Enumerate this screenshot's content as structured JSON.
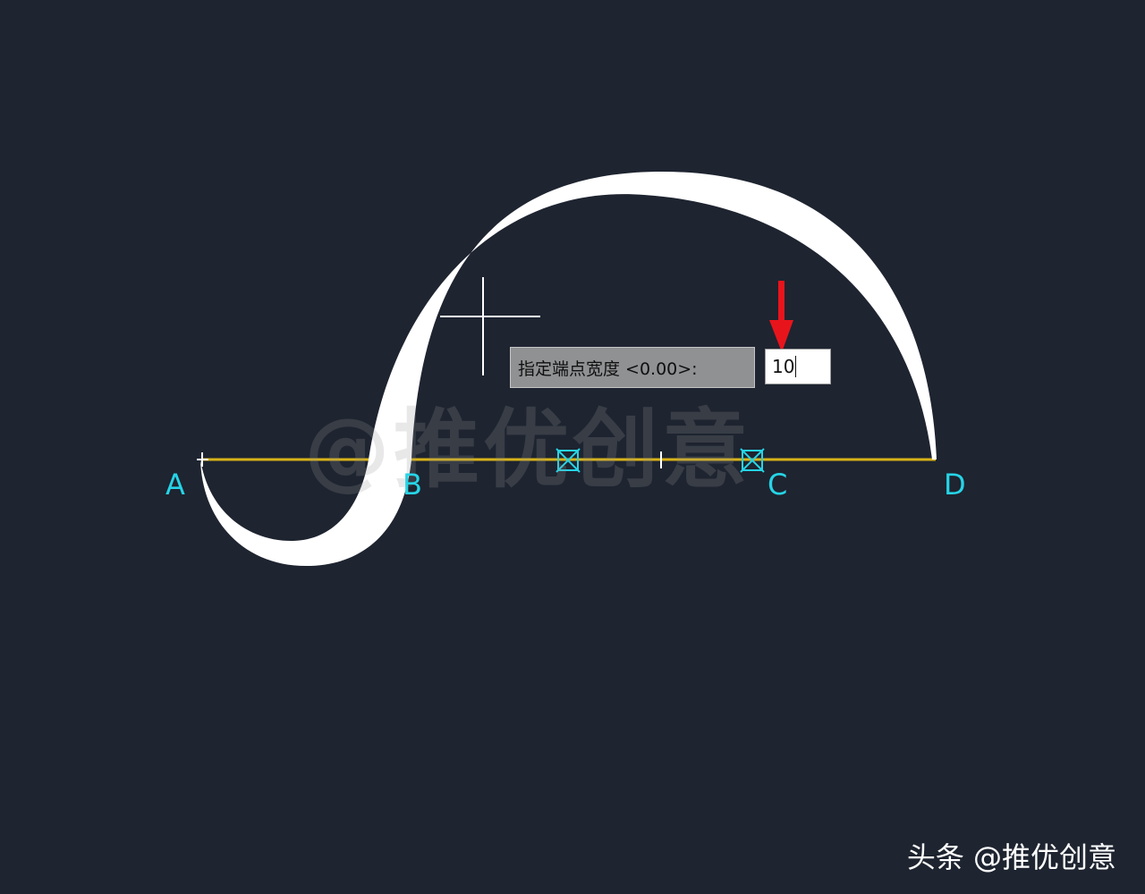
{
  "colors": {
    "background": "#1e2430",
    "curve": "#ffffff",
    "baseline": "#d9b318",
    "markers": "#26d4e6",
    "arrow": "#e8141c"
  },
  "points": {
    "a": "A",
    "b": "B",
    "c": "C",
    "d": "D"
  },
  "prompt": {
    "label": "指定端点宽度 <0.00>:",
    "input_value": "10"
  },
  "watermark": "@推优创意",
  "footer_brand": "头条 @推优创意",
  "icons": [
    "crosshair-cursor-icon",
    "osnap-marker-icon",
    "red-arrow-icon"
  ]
}
